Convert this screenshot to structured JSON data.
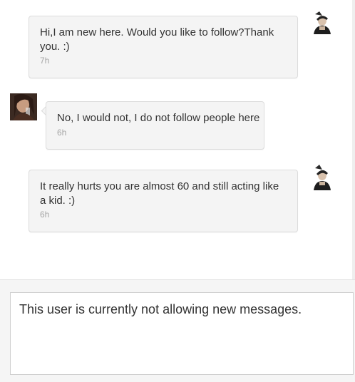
{
  "messages": [
    {
      "direction": "outgoing",
      "text": "Hi,I am new here. Would you like to follow?Thank you. :)",
      "time": "7h",
      "avatar_icon": "user-avatar-self"
    },
    {
      "direction": "incoming",
      "text": "No, I would not, I do not follow people here",
      "time": "6h",
      "avatar_icon": "user-avatar-other"
    },
    {
      "direction": "outgoing",
      "text": "It really hurts you are almost 60 and still acting like a kid. :)",
      "time": "6h",
      "avatar_icon": "user-avatar-self"
    }
  ],
  "composer": {
    "notice": "This user is currently not allowing new messages."
  },
  "colors": {
    "bubble_bg": "#f4f4f4",
    "bubble_border": "#dcdcdc",
    "text": "#333333",
    "time": "#a6a6a6",
    "composer_bg": "#f5f5f5"
  }
}
